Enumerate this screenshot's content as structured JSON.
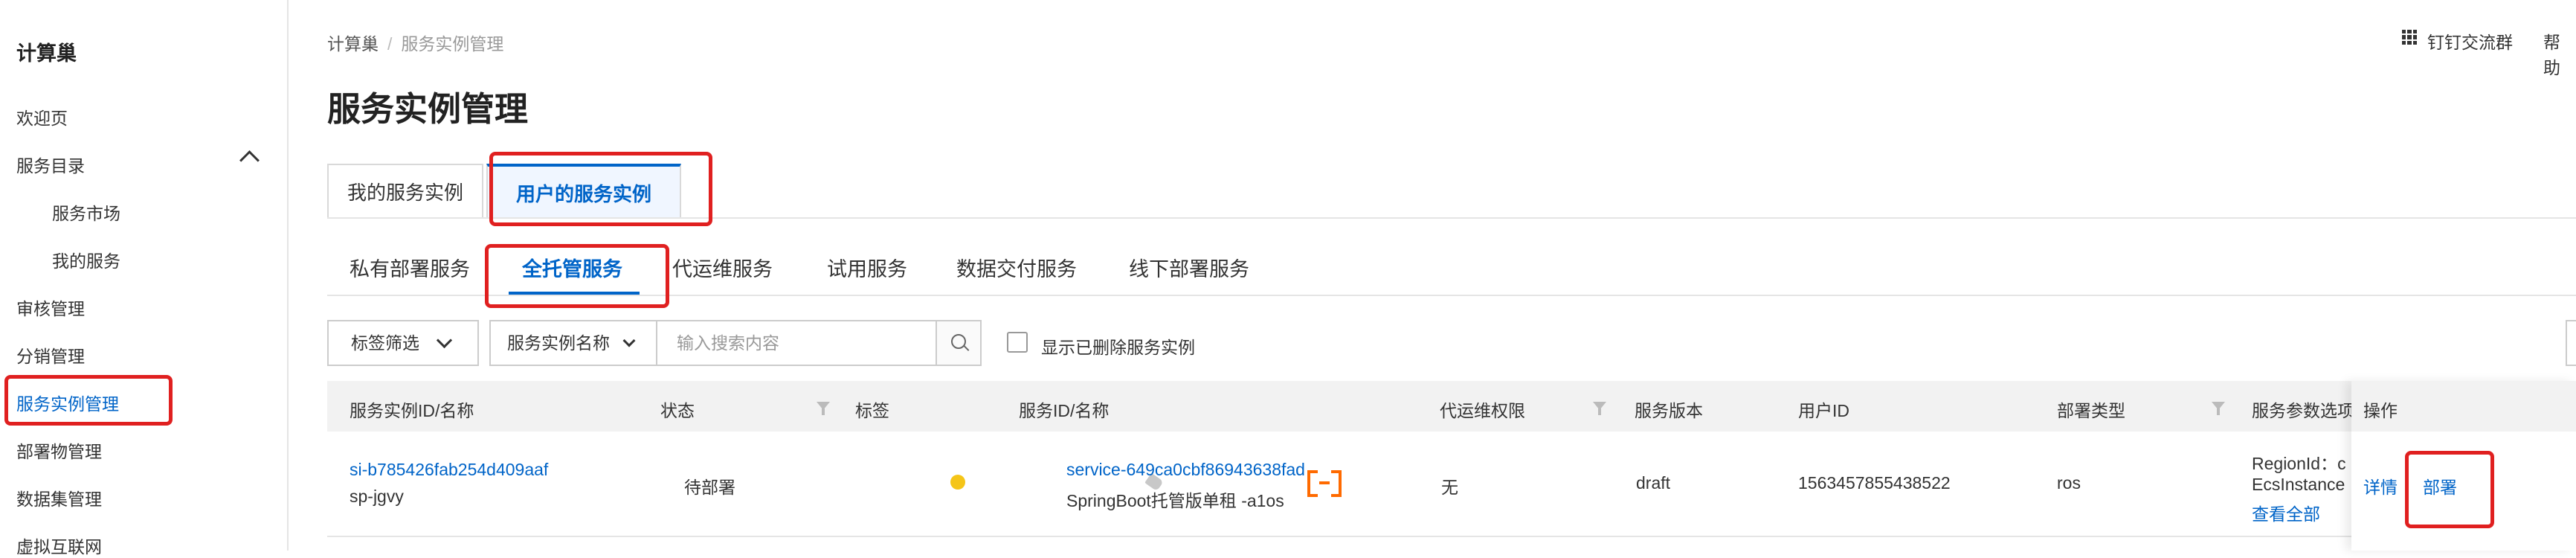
{
  "sidebar": {
    "title": "计算巢",
    "items": [
      {
        "label": "欢迎页"
      },
      {
        "label": "服务目录"
      },
      {
        "label": "服务市场"
      },
      {
        "label": "我的服务"
      },
      {
        "label": "审核管理"
      },
      {
        "label": "分销管理"
      },
      {
        "label": "服务实例管理"
      },
      {
        "label": "部署物管理"
      },
      {
        "label": "数据集管理"
      },
      {
        "label": "虚拟互联网"
      }
    ]
  },
  "breadcrumb": {
    "root": "计算巢",
    "separator": "/",
    "current": "服务实例管理"
  },
  "header": {
    "dingtalk": "钉钉交流群",
    "help": "帮助"
  },
  "page_title": "服务实例管理",
  "tabs_primary": [
    {
      "label": "我的服务实例"
    },
    {
      "label": "用户的服务实例"
    }
  ],
  "tabs_secondary": [
    {
      "label": "私有部署服务"
    },
    {
      "label": "全托管服务"
    },
    {
      "label": "代运维服务"
    },
    {
      "label": "试用服务"
    },
    {
      "label": "数据交付服务"
    },
    {
      "label": "线下部署服务"
    }
  ],
  "filters": {
    "tag_filter": "标签筛选",
    "field_select": "服务实例名称",
    "search_placeholder": "输入搜索内容",
    "show_deleted": "显示已删除服务实例"
  },
  "table": {
    "headers": [
      "服务实例ID/名称",
      "状态",
      "标签",
      "服务ID/名称",
      "代运维权限",
      "服务版本",
      "用户ID",
      "部署类型",
      "服务参数选项",
      "操作"
    ],
    "rows": [
      {
        "instance_id": "si-b785426fab254d409aaf",
        "instance_name": "sp-jgvy",
        "status": "待部署",
        "service_id": "service-649ca0cbf86943638fad",
        "service_name": "SpringBoot托管版单租 -a1os",
        "ops_permission": "无",
        "version": "draft",
        "user_id": "1563457855438522",
        "deploy_type": "ros",
        "params_line1": "RegionId：c",
        "params_line2": "EcsInstance",
        "params_more": "查看全部",
        "action_detail": "详情",
        "action_deploy": "部署"
      }
    ]
  },
  "colors": {
    "accent": "#0064c8",
    "highlight": "#e02020",
    "status_pending": "#f5c518",
    "service_icon": "#ff6a00"
  }
}
